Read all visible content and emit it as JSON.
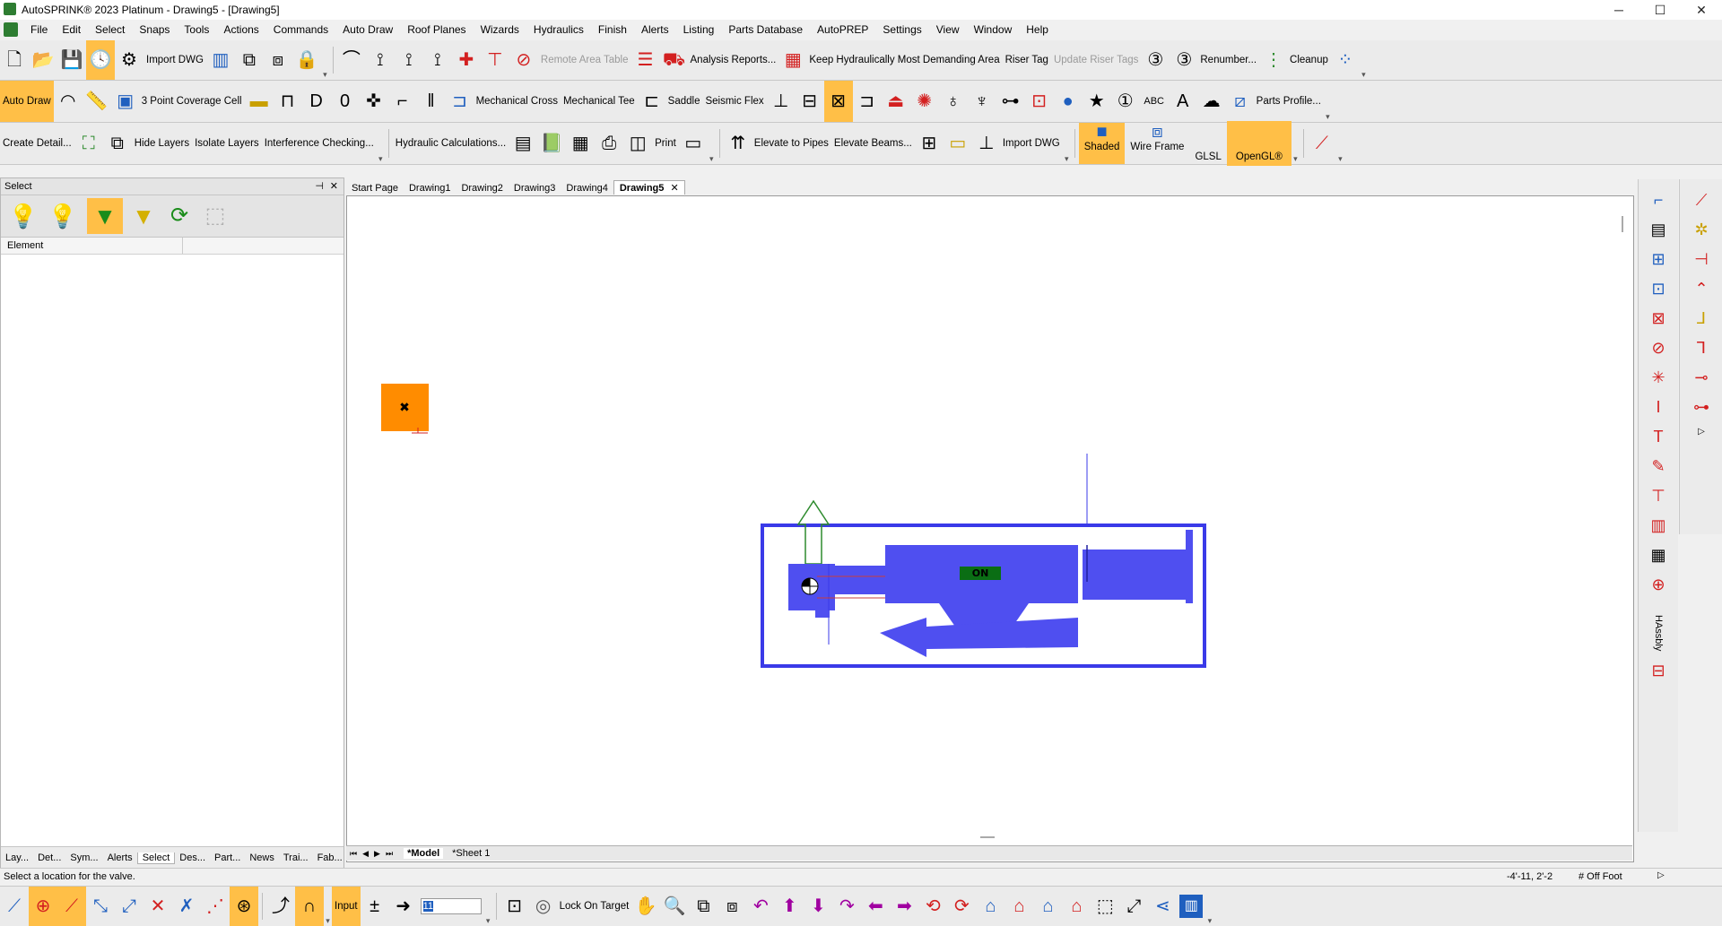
{
  "window": {
    "title": "AutoSPRINK® 2023 Platinum - Drawing5 - [Drawing5]",
    "controls": [
      "─",
      "☐",
      "✕"
    ]
  },
  "menu": [
    "File",
    "Edit",
    "Select",
    "Snaps",
    "Tools",
    "Actions",
    "Commands",
    "Auto Draw",
    "Roof Planes",
    "Wizards",
    "Hydraulics",
    "Finish",
    "Alerts",
    "Listing",
    "Parts Database",
    "AutoPREP",
    "Settings",
    "View",
    "Window",
    "Help"
  ],
  "toolbar1": {
    "import_dwg": "Import DWG",
    "remote_area_table": "Remote Area Table",
    "analysis_reports": "Analysis Reports...",
    "keep_hydraulically": "Keep Hydraulically Most Demanding Area",
    "riser_tag": "Riser Tag",
    "update_riser_tags": "Update Riser Tags",
    "renumber": "Renumber...",
    "cleanup": "Cleanup"
  },
  "toolbar2": {
    "auto_draw": "Auto Draw",
    "three_point": "3 Point Coverage Cell",
    "mechanical_cross": "Mechanical Cross",
    "mechanical_tee": "Mechanical Tee",
    "saddle": "Saddle",
    "seismic_flex": "Seismic Flex",
    "parts_profile": "Parts Profile..."
  },
  "toolbar3": {
    "create_detail": "Create Detail...",
    "hide_layers": "Hide Layers",
    "isolate_layers": "Isolate Layers",
    "interference": "Interference Checking...",
    "hydraulic_calc": "Hydraulic Calculations...",
    "print": "Print",
    "elevate_pipes": "Elevate to Pipes",
    "elevate_beams": "Elevate Beams...",
    "import_dwg": "Import DWG",
    "shaded": "Shaded",
    "wire_frame": "Wire Frame",
    "glsl": "GLSL",
    "opengl": "OpenGL®"
  },
  "left_panel": {
    "title": "Select",
    "column": "Element",
    "tabs": [
      "Lay...",
      "Det...",
      "Sym...",
      "Alerts",
      "Select",
      "Des...",
      "Part...",
      "News",
      "Trai...",
      "Fab..."
    ],
    "selected_tab": "Select"
  },
  "doc_tabs": [
    "Start Page",
    "Drawing1",
    "Drawing2",
    "Drawing3",
    "Drawing4",
    "Drawing5"
  ],
  "active_doc": "Drawing5",
  "sheet_tabs": [
    "*Model",
    "*Sheet 1"
  ],
  "canvas": {
    "valve_label": "ON"
  },
  "right_toolbar": {
    "vertical_label": "HAssbly"
  },
  "status": {
    "message": "Select a location for the valve.",
    "coords": "-4'-11, 2'-2",
    "units": "# Off Foot"
  },
  "bottom_toolbar": {
    "input_label": "Input",
    "input_value": "11",
    "lock_on_target": "Lock On Target"
  },
  "colors": {
    "valve_blue": "#4f4ff0",
    "outline_blue": "#3a3ae8",
    "orange_block": "#ff8c00",
    "active_button": "#ffbf47"
  }
}
